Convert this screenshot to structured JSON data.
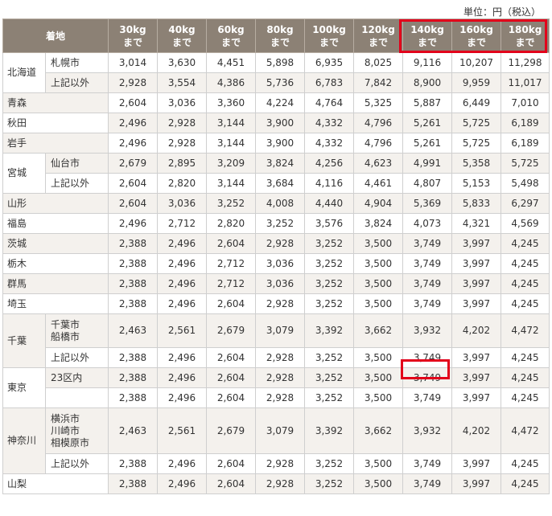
{
  "unit_note": "単位：円（税込）",
  "header": {
    "destination": "着地",
    "columns": [
      {
        "weight": "30kg",
        "suffix": "まで"
      },
      {
        "weight": "40kg",
        "suffix": "まで"
      },
      {
        "weight": "60kg",
        "suffix": "まで"
      },
      {
        "weight": "80kg",
        "suffix": "まで"
      },
      {
        "weight": "100kg",
        "suffix": "まで"
      },
      {
        "weight": "120kg",
        "suffix": "まで"
      },
      {
        "weight": "140kg",
        "suffix": "まで"
      },
      {
        "weight": "160kg",
        "suffix": "まで"
      },
      {
        "weight": "180kg",
        "suffix": "まで"
      }
    ]
  },
  "prefectures": [
    {
      "name": "北海道",
      "rows": [
        {
          "city": [
            "札幌市"
          ],
          "prices": [
            "3,014",
            "3,630",
            "4,451",
            "5,898",
            "6,935",
            "8,025",
            "9,116",
            "10,207",
            "11,298"
          ]
        },
        {
          "city": [
            "上記以外"
          ],
          "prices": [
            "2,928",
            "3,554",
            "4,386",
            "5,736",
            "6,783",
            "7,842",
            "8,900",
            "9,959",
            "11,017"
          ]
        }
      ]
    },
    {
      "name": "青森",
      "rows": [
        {
          "city": [],
          "prices": [
            "2,604",
            "3,036",
            "3,360",
            "4,224",
            "4,764",
            "5,325",
            "5,887",
            "6,449",
            "7,010"
          ]
        }
      ]
    },
    {
      "name": "秋田",
      "rows": [
        {
          "city": [],
          "prices": [
            "2,496",
            "2,928",
            "3,144",
            "3,900",
            "4,332",
            "4,796",
            "5,261",
            "5,725",
            "6,189"
          ]
        }
      ]
    },
    {
      "name": "岩手",
      "rows": [
        {
          "city": [],
          "prices": [
            "2,496",
            "2,928",
            "3,144",
            "3,900",
            "4,332",
            "4,796",
            "5,261",
            "5,725",
            "6,189"
          ]
        }
      ]
    },
    {
      "name": "宮城",
      "rows": [
        {
          "city": [
            "仙台市"
          ],
          "prices": [
            "2,679",
            "2,895",
            "3,209",
            "3,824",
            "4,256",
            "4,623",
            "4,991",
            "5,358",
            "5,725"
          ]
        },
        {
          "city": [
            "上記以外"
          ],
          "prices": [
            "2,604",
            "2,820",
            "3,144",
            "3,684",
            "4,116",
            "4,461",
            "4,807",
            "5,153",
            "5,498"
          ]
        }
      ]
    },
    {
      "name": "山形",
      "rows": [
        {
          "city": [],
          "prices": [
            "2,604",
            "3,036",
            "3,252",
            "4,008",
            "4,440",
            "4,904",
            "5,369",
            "5,833",
            "6,297"
          ]
        }
      ]
    },
    {
      "name": "福島",
      "rows": [
        {
          "city": [],
          "prices": [
            "2,496",
            "2,712",
            "2,820",
            "3,252",
            "3,576",
            "3,824",
            "4,073",
            "4,321",
            "4,569"
          ]
        }
      ]
    },
    {
      "name": "茨城",
      "rows": [
        {
          "city": [],
          "prices": [
            "2,388",
            "2,496",
            "2,604",
            "2,928",
            "3,252",
            "3,500",
            "3,749",
            "3,997",
            "4,245"
          ]
        }
      ]
    },
    {
      "name": "栃木",
      "rows": [
        {
          "city": [],
          "prices": [
            "2,388",
            "2,496",
            "2,712",
            "3,036",
            "3,252",
            "3,500",
            "3,749",
            "3,997",
            "4,245"
          ]
        }
      ]
    },
    {
      "name": "群馬",
      "rows": [
        {
          "city": [],
          "prices": [
            "2,388",
            "2,496",
            "2,712",
            "3,036",
            "3,252",
            "3,500",
            "3,749",
            "3,997",
            "4,245"
          ]
        }
      ]
    },
    {
      "name": "埼玉",
      "rows": [
        {
          "city": [],
          "prices": [
            "2,388",
            "2,496",
            "2,604",
            "2,928",
            "3,252",
            "3,500",
            "3,749",
            "3,997",
            "4,245"
          ]
        }
      ]
    },
    {
      "name": "千葉",
      "rows": [
        {
          "city": [
            "千葉市",
            "船橋市"
          ],
          "prices": [
            "2,463",
            "2,561",
            "2,679",
            "3,079",
            "3,392",
            "3,662",
            "3,932",
            "4,202",
            "4,472"
          ]
        },
        {
          "city": [
            "上記以外"
          ],
          "prices": [
            "2,388",
            "2,496",
            "2,604",
            "2,928",
            "3,252",
            "3,500",
            "3,749",
            "3,997",
            "4,245"
          ]
        }
      ]
    },
    {
      "name": "東京",
      "rows": [
        {
          "city": [
            "23区内"
          ],
          "prices": [
            "2,388",
            "2,496",
            "2,604",
            "2,928",
            "3,252",
            "3,500",
            "3,749",
            "3,997",
            "4,245"
          ]
        },
        {
          "city": [],
          "prices": [
            "2,388",
            "2,496",
            "2,604",
            "2,928",
            "3,252",
            "3,500",
            "3,749",
            "3,997",
            "4,245"
          ]
        }
      ]
    },
    {
      "name": "神奈川",
      "rows": [
        {
          "city": [
            "横浜市",
            "川崎市",
            "相模原市"
          ],
          "prices": [
            "2,463",
            "2,561",
            "2,679",
            "3,079",
            "3,392",
            "3,662",
            "3,932",
            "4,202",
            "4,472"
          ]
        },
        {
          "city": [
            "上記以外"
          ],
          "prices": [
            "2,388",
            "2,496",
            "2,604",
            "2,928",
            "3,252",
            "3,500",
            "3,749",
            "3,997",
            "4,245"
          ]
        }
      ]
    },
    {
      "name": "山梨",
      "rows": [
        {
          "city": [],
          "prices": [
            "2,388",
            "2,496",
            "2,604",
            "2,928",
            "3,252",
            "3,500",
            "3,749",
            "3,997",
            "4,245"
          ]
        }
      ]
    }
  ],
  "colors": {
    "header_bg": "#8c8175",
    "header_text": "#ffffff",
    "alt_row_bg": "#f4f1ed",
    "border": "#cfcfcf",
    "highlight": "#e2001a"
  }
}
